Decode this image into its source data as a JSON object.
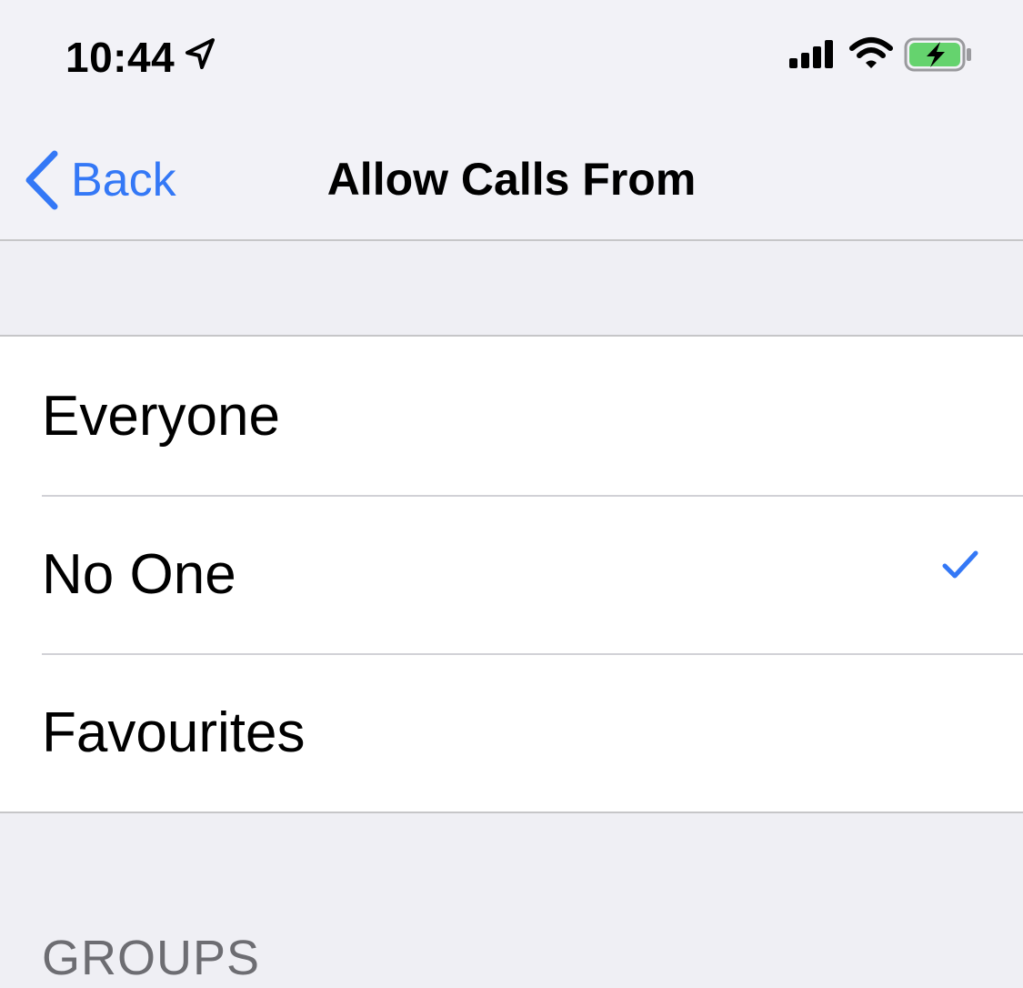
{
  "status_bar": {
    "time": "10:44",
    "icons": [
      "location-arrow-icon",
      "cellular-signal-icon",
      "wifi-icon",
      "battery-charging-icon"
    ]
  },
  "nav": {
    "back_label": "Back",
    "title": "Allow Calls From"
  },
  "options": [
    {
      "label": "Everyone",
      "selected": false
    },
    {
      "label": "No One",
      "selected": true
    },
    {
      "label": "Favourites",
      "selected": false
    }
  ],
  "section_header": "GROUPS",
  "colors": {
    "accent": "#3478f6",
    "battery_fill": "#65d36e",
    "background": "#efeff4",
    "section_text": "#6d6d72"
  }
}
